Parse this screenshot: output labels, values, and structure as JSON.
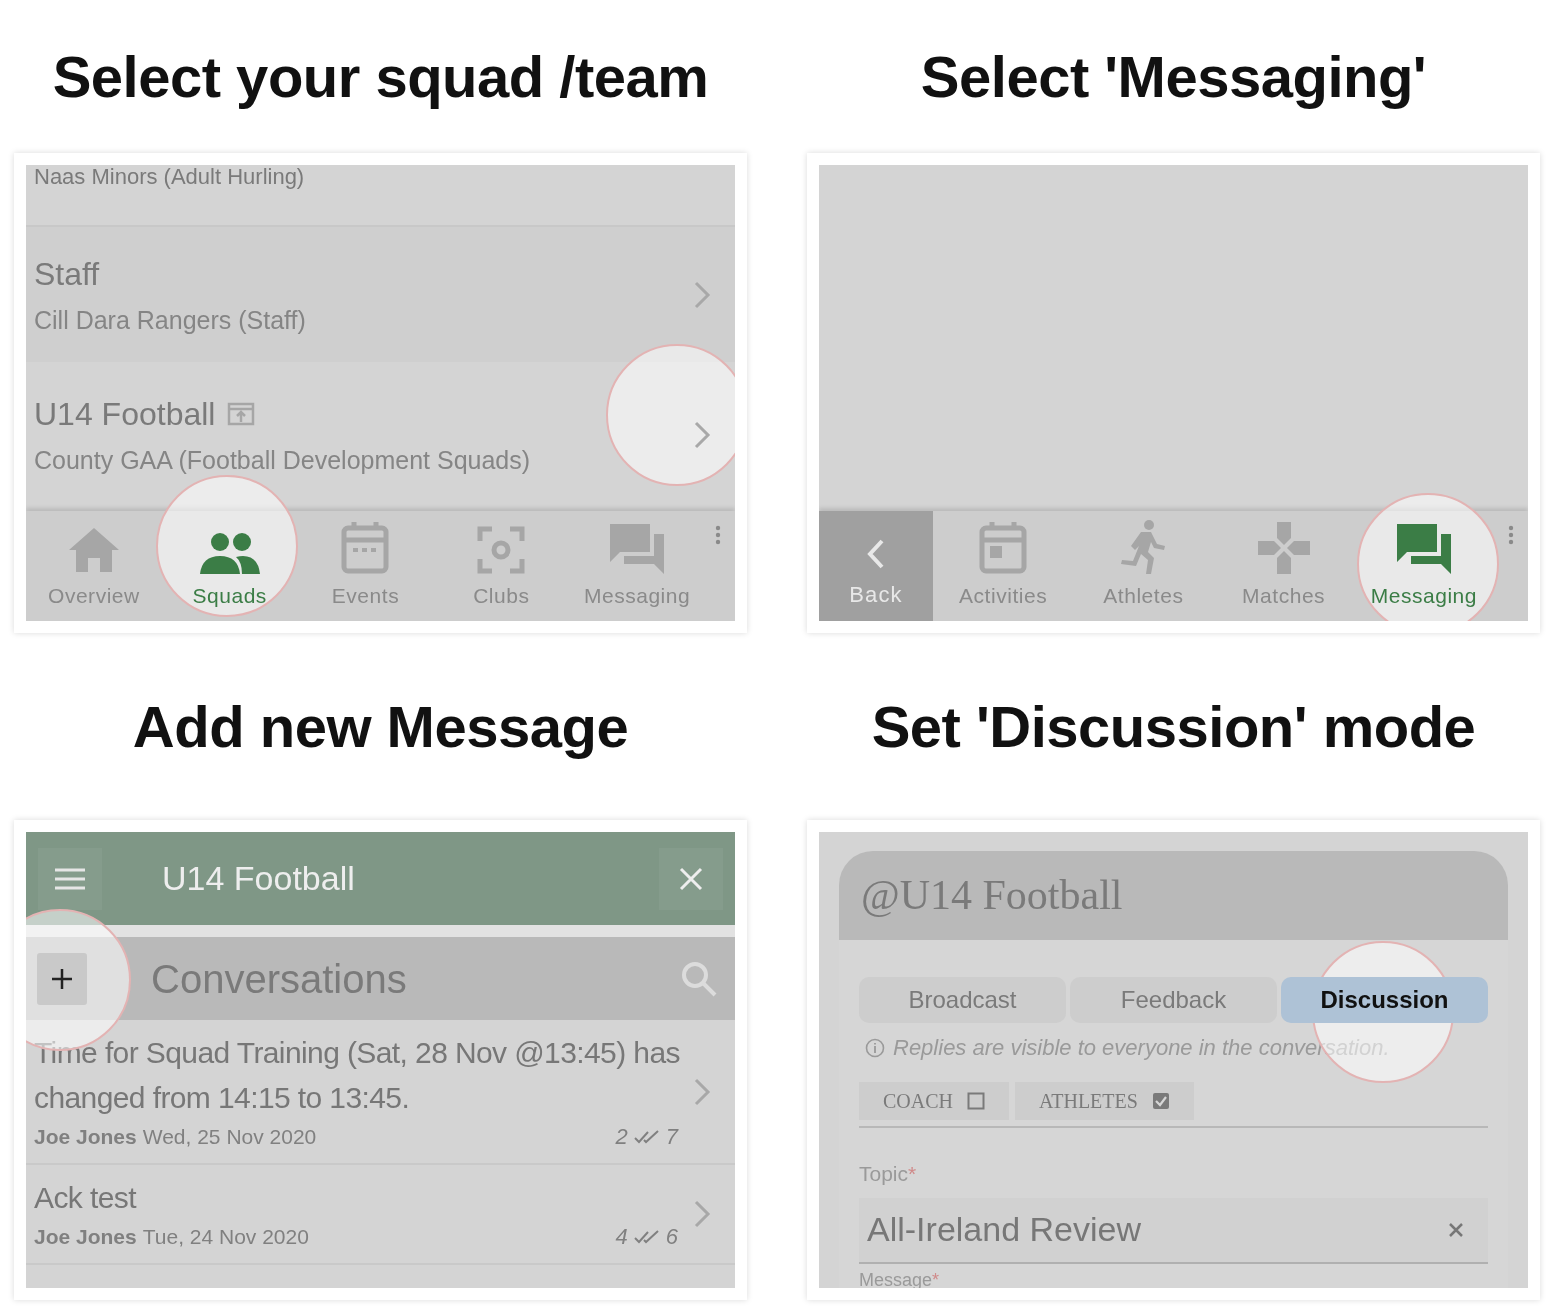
{
  "panels": [
    {
      "kind": "squads",
      "heading": "Select your squad /team",
      "rows": [
        {
          "title": "Naas Minors (Adult Hurling)",
          "linked": false
        },
        {
          "title": "Staff",
          "subtitle": "Cill Dara Rangers (Staff)",
          "linked": false
        },
        {
          "title": "U14 Football",
          "subtitle": "County GAA (Football Development Squads)",
          "linked": true
        }
      ],
      "nav": [
        {
          "label": "Overview",
          "selected": false
        },
        {
          "label": "Squads",
          "selected": true
        },
        {
          "label": "Events",
          "selected": false
        },
        {
          "label": "Clubs",
          "selected": false
        },
        {
          "label": "Messaging",
          "selected": false
        }
      ]
    },
    {
      "kind": "squad_menu",
      "heading": "Select 'Messaging'",
      "back": "Back",
      "nav": [
        {
          "label": "Activities",
          "selected": false
        },
        {
          "label": "Athletes",
          "selected": false
        },
        {
          "label": "Matches",
          "selected": false
        },
        {
          "label": "Messaging",
          "selected": true
        }
      ]
    },
    {
      "kind": "conversations",
      "heading": "Add new Message",
      "title": "U14 Football",
      "section": "Conversations",
      "items": [
        {
          "title": "Time for Squad Training (Sat, 28 Nov @13:45) has changed from 14:15 to 13:45.",
          "author": "Joe Jones",
          "date": "Wed, 25 Nov 2020",
          "sent": "2",
          "read": "7"
        },
        {
          "title": "Ack test",
          "author": "Joe Jones",
          "date": "Tue, 24 Nov 2020",
          "sent": "4",
          "read": "6"
        }
      ]
    },
    {
      "kind": "compose",
      "heading": "Set 'Discussion' mode",
      "title": "@U14 Football",
      "modes": [
        {
          "label": "Broadcast",
          "selected": false
        },
        {
          "label": "Feedback",
          "selected": false
        },
        {
          "label": "Discussion",
          "selected": true
        }
      ],
      "hint": "Replies are visible to everyone in the conversation.",
      "recipients": [
        {
          "label": "COACH",
          "checked": false
        },
        {
          "label": "ATHLETES",
          "checked": true
        }
      ],
      "topic_label": "Topic",
      "topic_mark": "*",
      "topic_value": "All-Ireland Review",
      "message_label": "Message",
      "message_mark": "*"
    }
  ]
}
